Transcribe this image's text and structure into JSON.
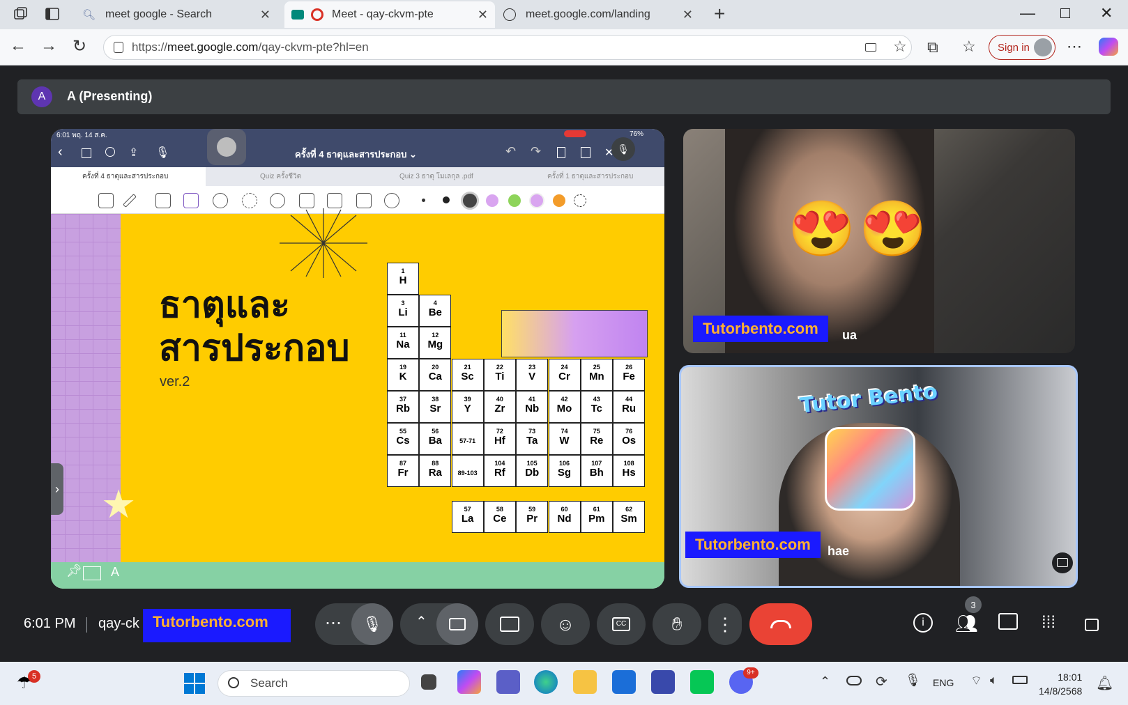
{
  "browser": {
    "tabs": [
      {
        "title": "meet google - Search",
        "active": false
      },
      {
        "title": "Meet - qay-ckvm-pte",
        "active": true
      },
      {
        "title": "meet.google.com/landing",
        "active": false
      }
    ],
    "new_tab": "+",
    "url_prefix": "https://",
    "url_domain": "meet.google.com",
    "url_path": "/qay-ckvm-pte?hl=en",
    "sign_in": "Sign in"
  },
  "meet": {
    "presenter_initial": "A",
    "presenting_label": "A (Presenting)",
    "ipad": {
      "status_left": "6:01  พฤ. 14 ส.ค.",
      "status_right": "76%",
      "doc_title": "ครั้งที่ 4 ธาตุและสารประกอบ ⌄",
      "doc_tabs": [
        "ครั้งที่ 4 ธาตุและสารประกอบ",
        "Quiz ครั้งชีวิต",
        "Quiz 3 ธาตุ โมเลกุล .pdf",
        "ครั้งที่ 1 ธาตุและสารประกอบ"
      ],
      "slide_title_line1": "ธาตุและ",
      "slide_title_line2": "สารประกอบ",
      "slide_version": "ver.2",
      "pen_colors": [
        "#333333",
        "#222222",
        "#444444",
        "#d9a5f0",
        "#8ed45a",
        "#d9a5f0",
        "#f39c2a"
      ],
      "elements": [
        {
          "n": "1",
          "s": "H"
        },
        {
          "n": "3",
          "s": "Li"
        },
        {
          "n": "4",
          "s": "Be"
        },
        {
          "n": "11",
          "s": "Na"
        },
        {
          "n": "12",
          "s": "Mg"
        },
        {
          "n": "19",
          "s": "K"
        },
        {
          "n": "20",
          "s": "Ca"
        },
        {
          "n": "21",
          "s": "Sc"
        },
        {
          "n": "22",
          "s": "Ti"
        },
        {
          "n": "23",
          "s": "V"
        },
        {
          "n": "24",
          "s": "Cr"
        },
        {
          "n": "25",
          "s": "Mn"
        },
        {
          "n": "26",
          "s": "Fe"
        },
        {
          "n": "37",
          "s": "Rb"
        },
        {
          "n": "38",
          "s": "Sr"
        },
        {
          "n": "39",
          "s": "Y"
        },
        {
          "n": "40",
          "s": "Zr"
        },
        {
          "n": "41",
          "s": "Nb"
        },
        {
          "n": "42",
          "s": "Mo"
        },
        {
          "n": "43",
          "s": "Tc"
        },
        {
          "n": "44",
          "s": "Ru"
        },
        {
          "n": "55",
          "s": "Cs"
        },
        {
          "n": "56",
          "s": "Ba"
        },
        {
          "n": "57-71",
          "s": ""
        },
        {
          "n": "72",
          "s": "Hf"
        },
        {
          "n": "73",
          "s": "Ta"
        },
        {
          "n": "74",
          "s": "W"
        },
        {
          "n": "75",
          "s": "Re"
        },
        {
          "n": "76",
          "s": "Os"
        },
        {
          "n": "87",
          "s": "Fr"
        },
        {
          "n": "88",
          "s": "Ra"
        },
        {
          "n": "89-103",
          "s": ""
        },
        {
          "n": "104",
          "s": "Rf"
        },
        {
          "n": "105",
          "s": "Db"
        },
        {
          "n": "106",
          "s": "Sg"
        },
        {
          "n": "107",
          "s": "Bh"
        },
        {
          "n": "108",
          "s": "Hs"
        },
        {
          "n": "57",
          "s": "La"
        },
        {
          "n": "58",
          "s": "Ce"
        },
        {
          "n": "59",
          "s": "Pr"
        },
        {
          "n": "60",
          "s": "Nd"
        },
        {
          "n": "61",
          "s": "Pm"
        },
        {
          "n": "62",
          "s": "Sm"
        }
      ]
    },
    "tile1": {
      "watermark": "Tutorbento.com",
      "name_suffix": "ua"
    },
    "tile2": {
      "watermark": "Tutorbento.com",
      "name_suffix": "hae",
      "logo_text": "Tutor Bento"
    },
    "footer": {
      "time": "6:01 PM",
      "meeting_code": "qay-ck",
      "watermark": "Tutorbento.com",
      "participants_count": "3"
    }
  },
  "taskbar": {
    "search_placeholder": "Search",
    "weather_badge": "5",
    "discord_badge": "9+",
    "lang": "ENG",
    "time": "18:01",
    "date": "14/8/2568"
  },
  "colors": {
    "end_call": "#ea4335",
    "meet_bg": "#202124",
    "slide_yellow": "#ffcc00",
    "watermark_bg": "#1a1aff",
    "watermark_text": "#ffb030"
  }
}
